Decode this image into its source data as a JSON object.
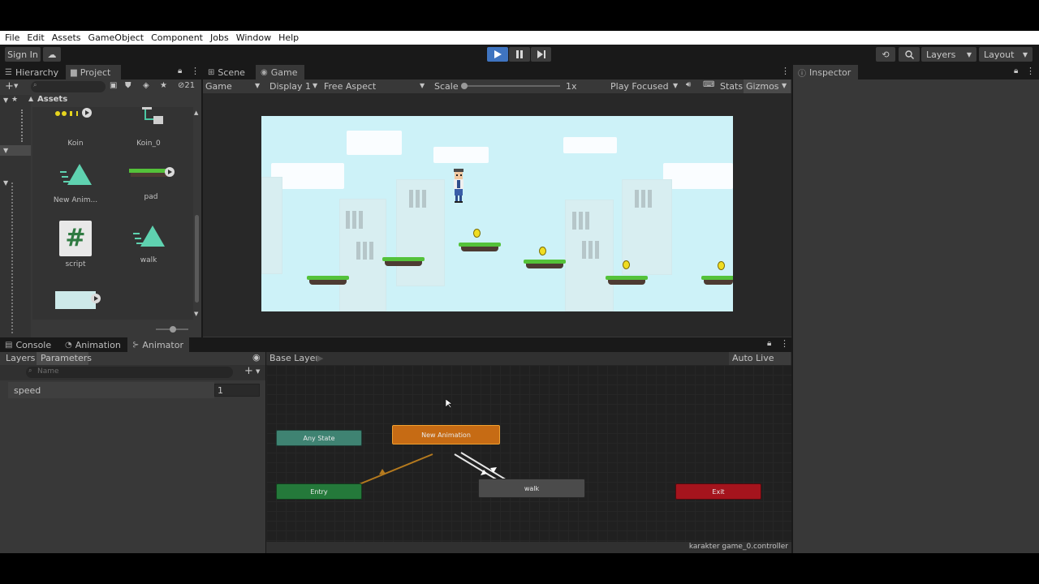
{
  "menu": [
    "File",
    "Edit",
    "Assets",
    "GameObject",
    "Component",
    "Jobs",
    "Window",
    "Help"
  ],
  "toolbar": {
    "sign_in": "Sign In",
    "layers": "Layers",
    "layout": "Layout"
  },
  "hierarchy": {
    "tab": "Hierarchy"
  },
  "project": {
    "tab": "Project",
    "hidden_count": "21",
    "breadcrumb": "Assets",
    "assets": [
      {
        "name": "Koin"
      },
      {
        "name": "Koin_0"
      },
      {
        "name": "New Anim..."
      },
      {
        "name": "pad"
      },
      {
        "name": "script"
      },
      {
        "name": "walk"
      },
      {
        "name": ""
      }
    ]
  },
  "game": {
    "tabs": [
      "Scene",
      "Game"
    ],
    "display_mode": "Game",
    "display": "Display 1",
    "aspect": "Free Aspect",
    "scale_label": "Scale",
    "scale_value": "1x",
    "play_mode": "Play Focused",
    "stats": "Stats",
    "gizmos": "Gizmos"
  },
  "inspector": {
    "tab": "Inspector"
  },
  "bottom": {
    "tabs": [
      "Console",
      "Animation",
      "Animator"
    ],
    "subtabs": [
      "Layers",
      "Parameters"
    ],
    "search_placeholder": "Name",
    "parameters": [
      {
        "name": "speed",
        "value": "1"
      }
    ],
    "base_layer": "Base Layer",
    "auto_live_link": "Auto Live Link",
    "controller_file": "karakter game_0.controller",
    "states": {
      "any": "Any State",
      "entry": "Entry",
      "new_anim": "New Animation",
      "walk": "walk",
      "exit": "Exit"
    }
  },
  "colors": {
    "any_state": "#3f8372",
    "entry": "#24793a",
    "default_state": "#c66b14",
    "state": "#4b4b4b",
    "exit": "#a5141d",
    "play_active": "#3f74c0",
    "sky": "#cdf2f8"
  }
}
